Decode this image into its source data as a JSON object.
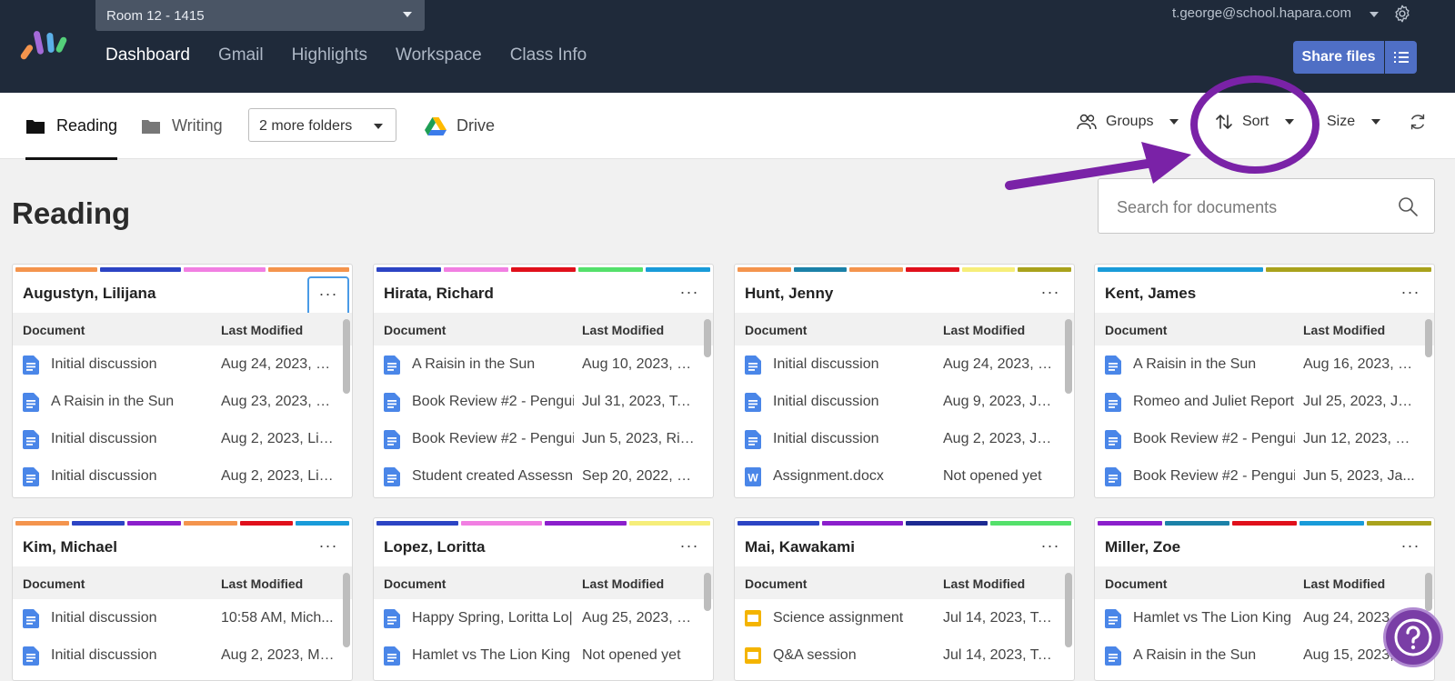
{
  "header": {
    "class_selector": "Room 12 - 1415",
    "nav": [
      "Dashboard",
      "Gmail",
      "Highlights",
      "Workspace",
      "Class Info"
    ],
    "active_nav": "Dashboard",
    "user_email": "t.george@school.hapara.com",
    "share_label": "Share files"
  },
  "toolbar": {
    "tab_reading": "Reading",
    "tab_writing": "Writing",
    "more_folders": "2 more folders",
    "drive": "Drive",
    "groups": "Groups",
    "sort": "Sort",
    "size": "Size"
  },
  "page": {
    "title": "Reading",
    "search_placeholder": "Search for documents",
    "col_document": "Document",
    "col_modified": "Last Modified",
    "more_actions": "···"
  },
  "colors": {
    "orange": "#f4944d",
    "blue": "#2c44c4",
    "pink": "#f17fe2",
    "red": "#e0101b",
    "green": "#54e06b",
    "sky": "#199bd9",
    "teal": "#1b81a8",
    "yellow": "#f6ee7a",
    "olive": "#a9a21c",
    "purple": "#8b1fcc",
    "navy": "#1c2a91",
    "annotation": "#7a22a7"
  },
  "cards": [
    {
      "name": "Augustyn, Lilijana",
      "stripes": [
        "orange",
        "blue",
        "pink",
        "orange"
      ],
      "rows": [
        {
          "icon": "doc",
          "name": "Initial discussion",
          "modified": "Aug 24, 2023, L..."
        },
        {
          "icon": "doc",
          "name": "A Raisin in the Sun",
          "modified": "Aug 23, 2023, L..."
        },
        {
          "icon": "doc",
          "name": "Initial discussion",
          "modified": "Aug 2, 2023, Lili..."
        },
        {
          "icon": "doc",
          "name": "Initial discussion",
          "modified": "Aug 2, 2023, Lili..."
        }
      ]
    },
    {
      "name": "Hirata, Richard",
      "stripes": [
        "blue",
        "pink",
        "red",
        "green",
        "sky"
      ],
      "rows": [
        {
          "icon": "doc",
          "name": "A Raisin in the Sun",
          "modified": "Aug 10, 2023, R..."
        },
        {
          "icon": "doc",
          "name": "Book Review #2 - Pengui",
          "modified": "Jul 31, 2023, To..."
        },
        {
          "icon": "doc",
          "name": "Book Review #2 - Pengui",
          "modified": "Jun 5, 2023, Ric..."
        },
        {
          "icon": "doc",
          "name": "Student created Assessn",
          "modified": "Sep 20, 2022, R..."
        }
      ]
    },
    {
      "name": "Hunt, Jenny",
      "stripes": [
        "orange",
        "teal",
        "orange",
        "red",
        "yellow",
        "olive"
      ],
      "rows": [
        {
          "icon": "doc",
          "name": "Initial discussion",
          "modified": "Aug 24, 2023, J..."
        },
        {
          "icon": "doc",
          "name": "Initial discussion",
          "modified": "Aug 9, 2023, Je..."
        },
        {
          "icon": "doc",
          "name": "Initial discussion",
          "modified": "Aug 2, 2023, Je..."
        },
        {
          "icon": "word",
          "name": "Assignment.docx",
          "modified": "Not opened yet"
        }
      ]
    },
    {
      "name": "Kent, James",
      "stripes": [
        "sky",
        "olive"
      ],
      "rows": [
        {
          "icon": "doc",
          "name": "A Raisin in the Sun",
          "modified": "Aug 16, 2023, J..."
        },
        {
          "icon": "doc",
          "name": "Romeo and Juliet Report",
          "modified": "Jul 25, 2023, Ja..."
        },
        {
          "icon": "doc",
          "name": "Book Review #2 - Pengui",
          "modified": "Jun 12, 2023, Ja..."
        },
        {
          "icon": "doc",
          "name": "Book Review #2 - Pengui",
          "modified": "Jun 5, 2023, Ja..."
        }
      ]
    },
    {
      "name": "Kim, Michael",
      "stripes": [
        "orange",
        "blue",
        "purple",
        "orange",
        "red",
        "sky"
      ],
      "rows": [
        {
          "icon": "doc",
          "name": "Initial discussion",
          "modified": "10:58 AM, Mich..."
        },
        {
          "icon": "doc",
          "name": "Initial discussion",
          "modified": "Aug 2, 2023, Mi..."
        }
      ]
    },
    {
      "name": "Lopez, Loritta",
      "stripes": [
        "blue",
        "pink",
        "purple",
        "yellow"
      ],
      "rows": [
        {
          "icon": "doc",
          "name": "Happy Spring, Loritta Lo|",
          "modified": "Aug 25, 2023, L..."
        },
        {
          "icon": "doc",
          "name": "Hamlet vs The Lion King",
          "modified": "Not opened yet"
        }
      ]
    },
    {
      "name": "Mai, Kawakami",
      "stripes": [
        "blue",
        "purple",
        "navy",
        "green"
      ],
      "rows": [
        {
          "icon": "slides",
          "name": "Science assignment",
          "modified": "Jul 14, 2023, To..."
        },
        {
          "icon": "slides",
          "name": "Q&A session",
          "modified": "Jul 14, 2023, To..."
        }
      ]
    },
    {
      "name": "Miller, Zoe",
      "stripes": [
        "purple",
        "teal",
        "red",
        "sky",
        "olive"
      ],
      "rows": [
        {
          "icon": "doc",
          "name": "Hamlet vs The Lion King",
          "modified": "Aug 24, 2023..."
        },
        {
          "icon": "doc",
          "name": "A Raisin in the Sun",
          "modified": "Aug 15, 2023, J..."
        }
      ]
    }
  ]
}
